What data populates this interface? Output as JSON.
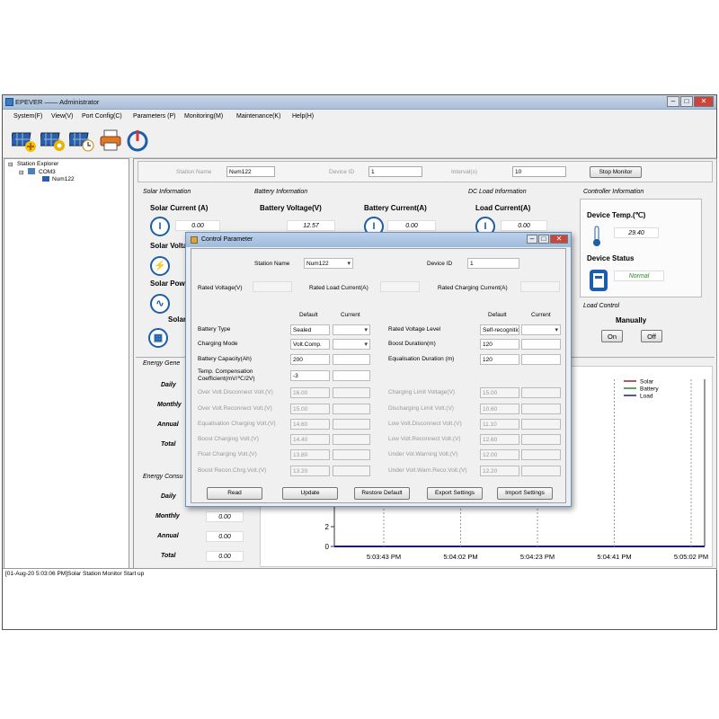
{
  "window": {
    "title": "EPEVER —— Administrator"
  },
  "menu": [
    "System(F)",
    "View(V)",
    "Port Config(C)",
    "Parameters (P)",
    "Monitoring(M)",
    "Maintenance(K)",
    "Help(H)"
  ],
  "toolbar": [
    "station-add-icon",
    "station-config-icon",
    "station-clock-icon",
    "printer-icon",
    "power-icon"
  ],
  "tree": {
    "root": "Station Explorer",
    "port": "COM3",
    "station": "Num122"
  },
  "top": {
    "station_name_label": "Station Name",
    "station_name": "Num122",
    "device_id_label": "Device ID",
    "device_id": "1",
    "interval_label": "Interval(s)",
    "interval": "10",
    "stop_button": "Stop Monitor"
  },
  "solar": {
    "group": "Solar Information",
    "current_label": "Solar Current (A)",
    "current": "0.00",
    "volt_label": "Solar Volta",
    "power_label": "Solar Pow",
    "solar_label": "Solar"
  },
  "battery": {
    "group": "Battery Information",
    "voltage_label": "Battery Voltage(V)",
    "voltage": "12.57",
    "current_label": "Battery Current(A)",
    "current": "0.00"
  },
  "dcload": {
    "group": "DC Load Information",
    "current_label": "Load Current(A)",
    "current": "0.00"
  },
  "controller": {
    "group": "Controller Information",
    "temp_label": "Device Temp.(℃)",
    "temp": "29.40",
    "status_label": "Device Status",
    "status": "Normal"
  },
  "load_control": {
    "group": "Load Control",
    "mode": "Manually",
    "on": "On",
    "off": "Off"
  },
  "energy_gen": {
    "group": "Energy Gene",
    "rows": [
      "Daily",
      "Monthly",
      "Annual",
      "Total"
    ]
  },
  "energy_con": {
    "group": "Energy Consu",
    "rows": [
      "Daily",
      "Monthly",
      "Annual",
      "Total"
    ],
    "values": [
      "0.00",
      "0.00",
      "0.00"
    ]
  },
  "chart": {
    "legend": [
      "Solar",
      "Battery",
      "Load"
    ],
    "legend_colors": [
      "#a02020",
      "#2a8a2a",
      "#1a1a8a"
    ],
    "yticks": [
      "2",
      "0"
    ],
    "xticks": [
      "5:03:43 PM",
      "5:04:02 PM",
      "5:04:23 PM",
      "5:04:41 PM",
      "5:05:02 PM"
    ]
  },
  "status_log": "[01-Aug-20 5:03:06 PM]Solar Station Monitor Start up",
  "dialog": {
    "title": "Control Parameter",
    "station_name_label": "Station Name",
    "station_name": "Num122",
    "device_id_label": "Device ID",
    "device_id": "1",
    "rated_voltage": "Rated Voltage(V)",
    "rated_load": "Rated Load Current(A)",
    "rated_charging": "Rated Charging Current(A)",
    "default_col": "Default",
    "current_col": "Current",
    "left": [
      {
        "label": "Battery Type",
        "def": "Sealed",
        "sel": true
      },
      {
        "label": "Charging Mode",
        "def": "Volt.Comp.",
        "sel": true
      },
      {
        "label": "Battery Capacity(Ah)",
        "def": "200"
      },
      {
        "label": "Temp. Compensation Coefficient(mV/℃/2V)",
        "def": "-3"
      },
      {
        "label": "Over Volt.Disconnect Volt.(V)",
        "def": "16.00",
        "dis": true
      },
      {
        "label": "Over Volt.Reconnect Volt.(V)",
        "def": "15.00",
        "dis": true
      },
      {
        "label": "Equalisation Charging Volt.(V)",
        "def": "14.60",
        "dis": true
      },
      {
        "label": "Boost Charging Volt.(V)",
        "def": "14.40",
        "dis": true
      },
      {
        "label": "Float Charging Volt.(V)",
        "def": "13.80",
        "dis": true
      },
      {
        "label": "Boost Recon.Chrg.Volt.(V)",
        "def": "13.20",
        "dis": true
      }
    ],
    "right": [
      {
        "label": "Rated Voltage Level",
        "def": "Self-recognitio",
        "sel": true
      },
      {
        "label": "Boost Duration(m)",
        "def": "120"
      },
      {
        "label": "Equalisation Duration (m)",
        "def": "120"
      },
      {
        "label": "",
        "def": ""
      },
      {
        "label": "Charging Limit Voltage(V)",
        "def": "15.00",
        "dis": true
      },
      {
        "label": "Discharging Limit Volt.(V)",
        "def": "10.60",
        "dis": true
      },
      {
        "label": "Low Volt.Disconnect Volt.(V)",
        "def": "11.10",
        "dis": true
      },
      {
        "label": "Low Volt.Reconnect Volt.(V)",
        "def": "12.60",
        "dis": true
      },
      {
        "label": "Under Vol.Warning Volt.(V)",
        "def": "12.00",
        "dis": true
      },
      {
        "label": "Under Volt.Warn.Reco.Volt.(V)",
        "def": "12.20",
        "dis": true
      }
    ],
    "buttons": [
      "Read",
      "Update",
      "Restore Default",
      "Export Settings",
      "Import Settings"
    ]
  }
}
